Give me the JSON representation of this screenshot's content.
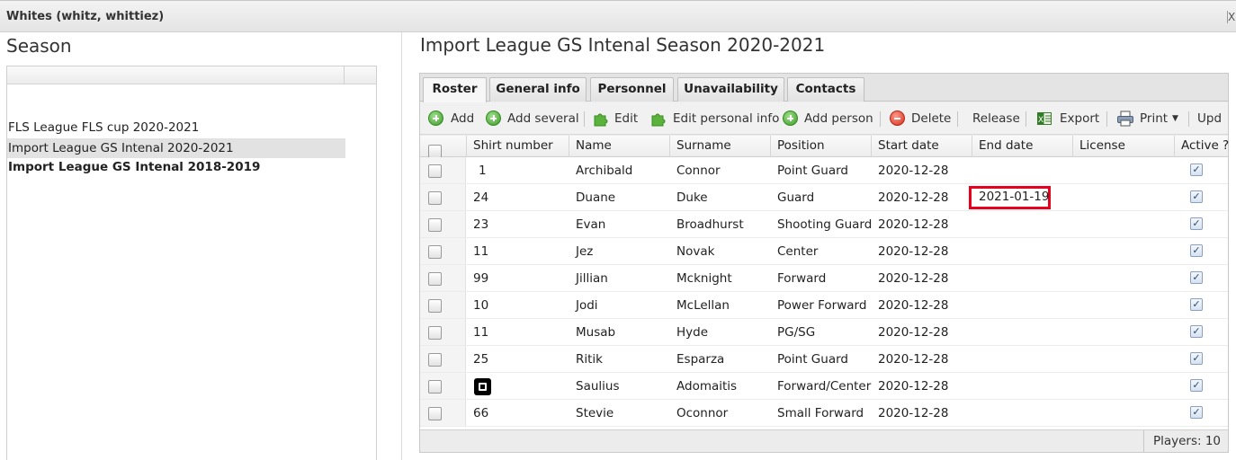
{
  "window": {
    "title": "Whites (whitz, whittiez)",
    "close_glyph": "X"
  },
  "season_panel": {
    "heading": "Season",
    "items": [
      {
        "label": "FLS League FLS cup 2020-2021",
        "selected": false,
        "bold": false
      },
      {
        "label": "Import League GS Intenal 2020-2021",
        "selected": true,
        "bold": false
      },
      {
        "label": "Import League GS Intenal 2018-2019",
        "selected": false,
        "bold": true
      }
    ]
  },
  "main": {
    "title": "Import League GS Intenal Season 2020-2021",
    "tabs": [
      {
        "label": "Roster",
        "active": true
      },
      {
        "label": "General info",
        "active": false
      },
      {
        "label": "Personnel",
        "active": false
      },
      {
        "label": "Unavailability",
        "active": false
      },
      {
        "label": "Contacts",
        "active": false
      }
    ],
    "toolbar": {
      "add": "Add",
      "add_several": "Add several",
      "edit": "Edit",
      "edit_personal_info": "Edit personal info",
      "add_person": "Add person",
      "delete": "Delete",
      "release": "Release",
      "export": "Export",
      "print": "Print",
      "update": "Upd"
    },
    "columns": [
      "Shirt number",
      "Name",
      "Surname",
      "Position",
      "Start date",
      "End date",
      "License",
      "Active ?"
    ],
    "rows": [
      {
        "shirt": "1",
        "name": "Archibald",
        "surname": "Connor",
        "position": "Point Guard",
        "start": "2020-12-28",
        "end": "",
        "license": "",
        "active": true
      },
      {
        "shirt": "24",
        "name": "Duane",
        "surname": "Duke",
        "position": "Guard",
        "start": "2020-12-28",
        "end": "2021-01-19",
        "license": "",
        "active": true
      },
      {
        "shirt": "23",
        "name": "Evan",
        "surname": "Broadhurst",
        "position": "Shooting Guard",
        "start": "2020-12-28",
        "end": "",
        "license": "",
        "active": true
      },
      {
        "shirt": "11",
        "name": "Jez",
        "surname": "Novak",
        "position": "Center",
        "start": "2020-12-28",
        "end": "",
        "license": "",
        "active": true
      },
      {
        "shirt": "99",
        "name": "Jillian",
        "surname": "Mcknight",
        "position": "Forward",
        "start": "2020-12-28",
        "end": "",
        "license": "",
        "active": true
      },
      {
        "shirt": "10",
        "name": "Jodi",
        "surname": "McLellan",
        "position": "Power Forward",
        "start": "2020-12-28",
        "end": "",
        "license": "",
        "active": true
      },
      {
        "shirt": "11",
        "name": "Musab",
        "surname": "Hyde",
        "position": "PG/SG",
        "start": "2020-12-28",
        "end": "",
        "license": "",
        "active": true
      },
      {
        "shirt": "25",
        "name": "Ritik",
        "surname": "Esparza",
        "position": "Point Guard",
        "start": "2020-12-28",
        "end": "",
        "license": "",
        "active": true
      },
      {
        "shirt": "",
        "shirt_icon": "shirt-placeholder-icon",
        "name": "Saulius",
        "surname": "Adomaitis",
        "position": "Forward/Center",
        "start": "2020-12-28",
        "end": "",
        "license": "",
        "active": true
      },
      {
        "shirt": "66",
        "name": "Stevie",
        "surname": "Oconnor",
        "position": "Small Forward",
        "start": "2020-12-28",
        "end": "",
        "license": "",
        "active": true
      }
    ],
    "footer": {
      "players_count": "Players: 10"
    }
  },
  "colors": {
    "highlight": "#e8001c",
    "add_green": "#3c9a2a",
    "delete_red": "#d62d1b"
  }
}
